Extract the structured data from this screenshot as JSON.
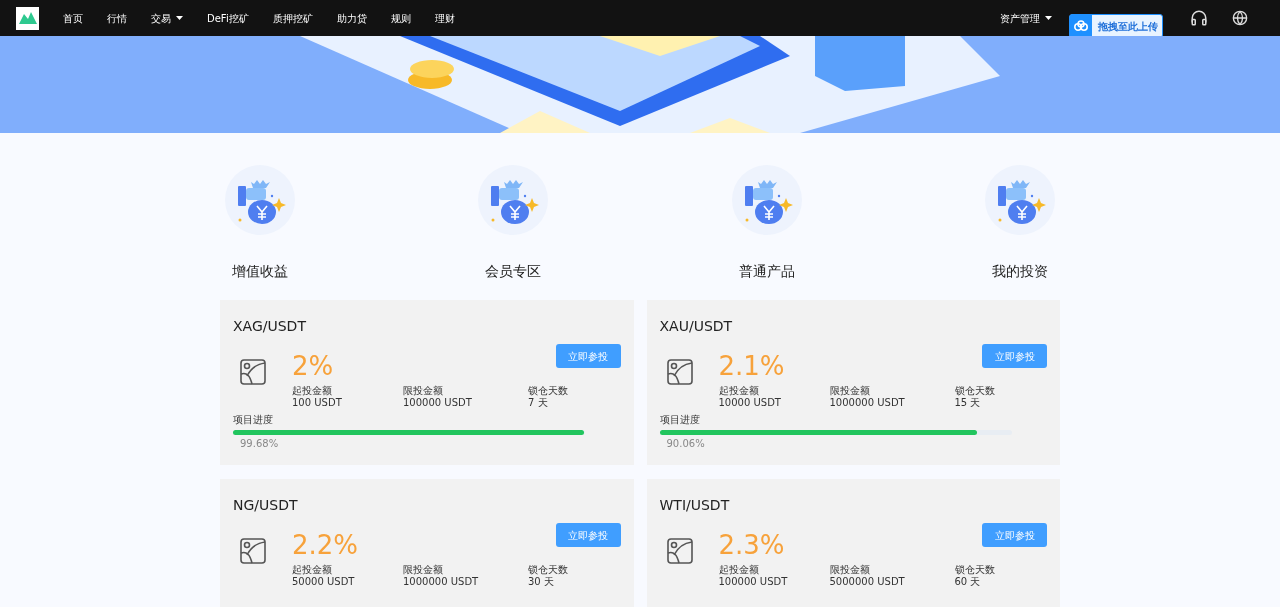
{
  "nav": {
    "items": [
      {
        "label": "首页",
        "dropdown": false
      },
      {
        "label": "行情",
        "dropdown": false
      },
      {
        "label": "交易",
        "dropdown": true
      },
      {
        "label": "DeFi挖矿",
        "dropdown": false
      },
      {
        "label": "质押挖矿",
        "dropdown": false
      },
      {
        "label": "助力贷",
        "dropdown": false
      },
      {
        "label": "规则",
        "dropdown": false
      },
      {
        "label": "理财",
        "dropdown": false
      }
    ],
    "asset_menu": "资产管理"
  },
  "upload_popup": {
    "label": "拖拽至此上传"
  },
  "categories": [
    "增值收益",
    "会员专区",
    "普通产品",
    "我的投资"
  ],
  "products": [
    {
      "pair": "XAG/USDT",
      "rate": "2%",
      "button": "立即参投",
      "stats": [
        {
          "label": "起投金额",
          "value": "100 USDT"
        },
        {
          "label": "限投金额",
          "value": "100000 USDT"
        },
        {
          "label": "锁仓天数",
          "value": "7 天"
        }
      ],
      "progress": {
        "label": "项目进度",
        "level": 0.9968,
        "reading": "99.68%"
      }
    },
    {
      "pair": "XAU/USDT",
      "rate": "2.1%",
      "button": "立即参投",
      "stats": [
        {
          "label": "起投金额",
          "value": "10000 USDT"
        },
        {
          "label": "限投金额",
          "value": "1000000 USDT"
        },
        {
          "label": "锁仓天数",
          "value": "15 天"
        }
      ],
      "progress": {
        "label": "项目进度",
        "level": 0.9006,
        "reading": "90.06%"
      }
    },
    {
      "pair": "NG/USDT",
      "rate": "2.2%",
      "button": "立即参投",
      "stats": [
        {
          "label": "起投金额",
          "value": "50000 USDT"
        },
        {
          "label": "限投金额",
          "value": "1000000 USDT"
        },
        {
          "label": "锁仓天数",
          "value": "30 天"
        }
      ]
    },
    {
      "pair": "WTI/USDT",
      "rate": "2.3%",
      "button": "立即参投",
      "stats": [
        {
          "label": "起投金额",
          "value": "100000 USDT"
        },
        {
          "label": "限投金额",
          "value": "5000000 USDT"
        },
        {
          "label": "锁仓天数",
          "value": "60 天"
        }
      ]
    }
  ]
}
